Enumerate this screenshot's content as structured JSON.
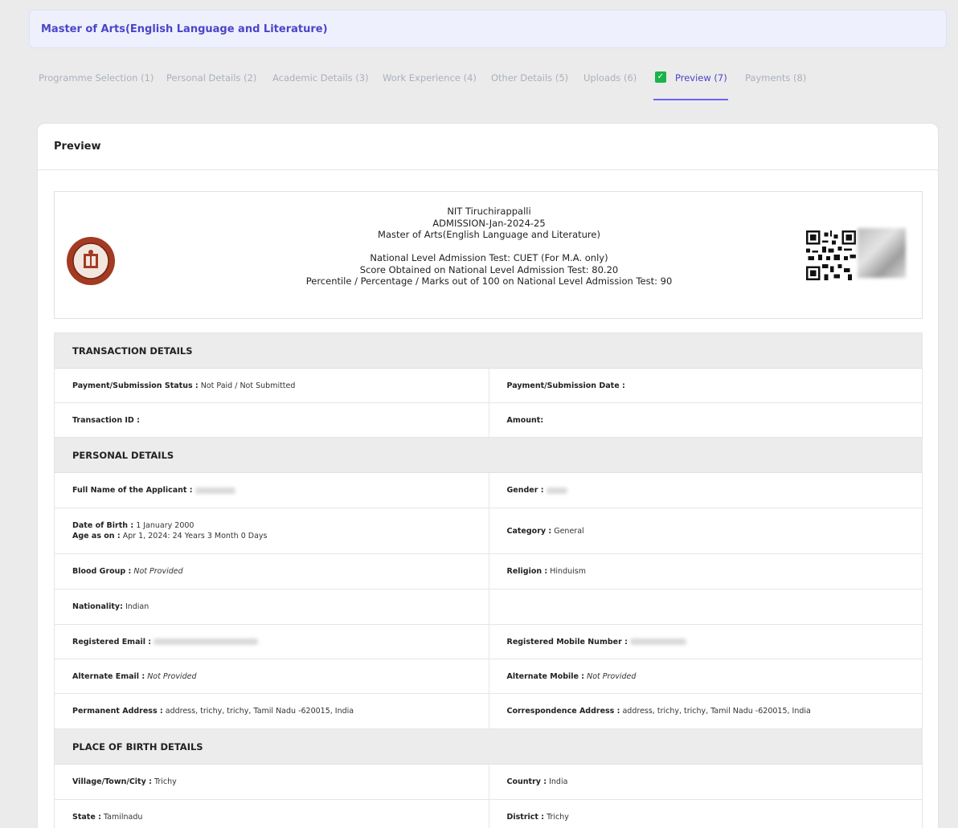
{
  "program_header": "Master of Arts(English Language and Literature)",
  "steps": [
    {
      "label": "Programme Selection",
      "num": "(1)"
    },
    {
      "label": "Personal Details",
      "num": "(2)"
    },
    {
      "label": "Academic Details",
      "num": "(3)"
    },
    {
      "label": "Work Experience",
      "num": "(4)"
    },
    {
      "label": "Other Details",
      "num": "(5)"
    },
    {
      "label": "Uploads",
      "num": "(6)"
    },
    {
      "label": "Preview",
      "num": "(7)"
    },
    {
      "label": "Payments",
      "num": "(8)"
    }
  ],
  "active_step_index": 6,
  "card_title": "Preview",
  "header": {
    "line1": "NIT Tiruchirappalli",
    "line2": "ADMISSION-Jan-2024-25",
    "line3": "Master of Arts(English Language and Literature)",
    "line4": "National Level Admission Test: CUET (For M.A. only)",
    "line5": "Score Obtained on National Level Admission Test: 80.20",
    "line6": "Percentile / Percentage / Marks out of 100 on National Level Admission Test: 90"
  },
  "sections": {
    "transaction": {
      "title": "TRANSACTION DETAILS",
      "payment_status_label": "Payment/Submission Status :",
      "payment_status_value": "Not Paid / Not Submitted",
      "payment_date_label": "Payment/Submission Date :",
      "transaction_id_label": "Transaction ID :",
      "amount_label": "Amount:"
    },
    "personal": {
      "title": "PERSONAL DETAILS",
      "full_name_label": "Full Name of the Applicant :",
      "gender_label": "Gender :",
      "dob_label": "Date of Birth :",
      "dob_value": "1 January 2000",
      "age_label": "Age as on :",
      "age_value": "Apr 1, 2024: 24 Years 3 Month 0 Days",
      "category_label": "Category :",
      "category_value": "General",
      "blood_label": "Blood Group :",
      "blood_value": "Not Provided",
      "religion_label": "Religion :",
      "religion_value": "Hinduism",
      "nationality_label": "Nationality:",
      "nationality_value": "Indian",
      "email_label": "Registered Email :",
      "mobile_label": "Registered Mobile Number :",
      "alt_email_label": "Alternate Email :",
      "alt_email_value": "Not Provided",
      "alt_mobile_label": "Alternate Mobile :",
      "alt_mobile_value": "Not Provided",
      "perm_addr_label": "Permanent Address :",
      "perm_addr_value": "address, trichy, trichy, Tamil Nadu -620015, India",
      "corr_addr_label": "Correspondence Address :",
      "corr_addr_value": "address, trichy, trichy, Tamil Nadu -620015, India"
    },
    "birth": {
      "title": "PLACE OF BIRTH DETAILS",
      "village_label": "Village/Town/City :",
      "village_value": "Trichy",
      "country_label": "Country :",
      "country_value": "India",
      "state_label": "State :",
      "state_value": "Tamilnadu",
      "district_label": "District :",
      "district_value": "Trichy"
    }
  },
  "colors": {
    "accent": "#4b45c8",
    "step_inactive": "#aab0be",
    "check_green": "#19b34a",
    "background": "#ebebeb"
  }
}
